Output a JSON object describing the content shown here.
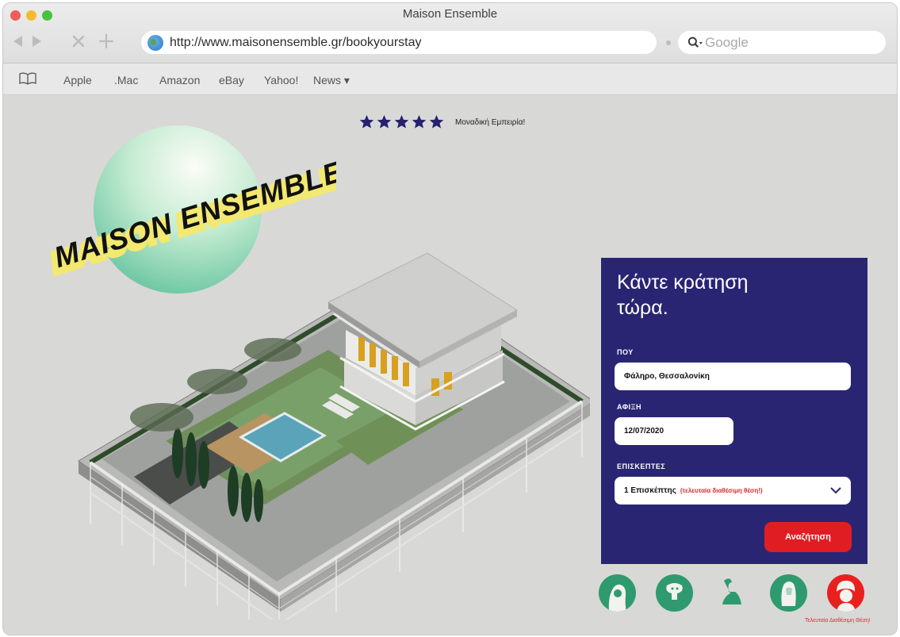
{
  "window": {
    "title": "Maison Ensemble"
  },
  "toolbar": {
    "url": "http://www.maisonensemble.gr/bookyourstay",
    "search_placeholder": "Google"
  },
  "bookmarks": [
    "Apple",
    ".Mac",
    "Amazon",
    "eBay",
    "Yahoo!",
    "News ▾"
  ],
  "hero": {
    "logo_text": "MAISON ENSEMBLE",
    "rating_stars": 5,
    "rating_caption": "Μοναδική Εμπειρία!"
  },
  "booking": {
    "heading_line1": "Κάντε κράτηση",
    "heading_line2": "τώρα.",
    "where_label": "ΠΟΥ",
    "where_value": "Φάληρο, Θεσσαλονίκη",
    "arrival_label": "ΑΦΙΞΗ",
    "arrival_value": "12/07/2020",
    "guests_label": "ΕΠΙΣΚΕΠΤΕΣ",
    "guests_value": "1 Επισκέπτης",
    "guests_note": "(τελευταία διαθέσιμη θέση!)",
    "search_button": "Αναζήτηση"
  },
  "avatars": {
    "caption": "Τελευταία Διαθέσιμη Θέση!"
  },
  "colors": {
    "panel": "#2a2572",
    "accent_red": "#e11d24",
    "avatar_green": "#2f9a6e",
    "star": "#25216e"
  }
}
